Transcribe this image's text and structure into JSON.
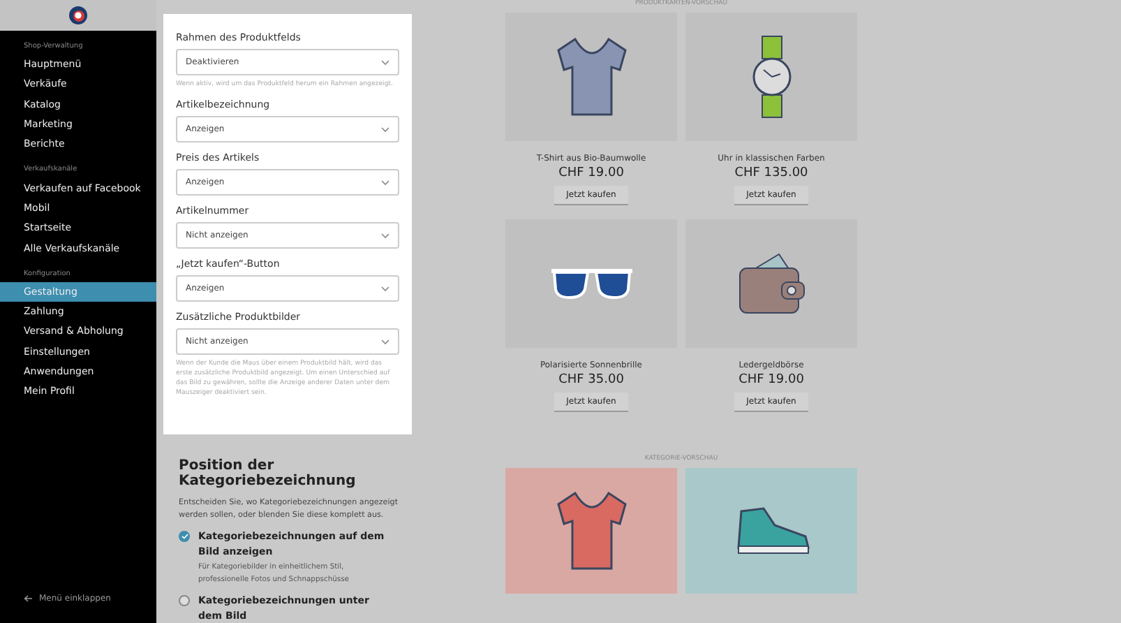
{
  "sidebar": {
    "sections": [
      {
        "title": "Shop-Verwaltung",
        "items": [
          {
            "label": "Hauptmenü",
            "selected": false
          },
          {
            "label": "Verkäufe",
            "selected": false
          },
          {
            "label": "Katalog",
            "selected": false
          },
          {
            "label": "Marketing",
            "selected": false
          },
          {
            "label": "Berichte",
            "selected": false
          }
        ]
      },
      {
        "title": "Verkaufskanäle",
        "items": [
          {
            "label": "Verkaufen auf Facebook",
            "selected": false
          },
          {
            "label": "Mobil",
            "selected": false
          },
          {
            "label": "Startseite",
            "selected": false
          },
          {
            "label": "Alle Verkaufskanäle",
            "selected": false
          }
        ]
      },
      {
        "title": "Konfiguration",
        "items": [
          {
            "label": "Gestaltung",
            "selected": true
          },
          {
            "label": "Zahlung",
            "selected": false
          },
          {
            "label": "Versand & Abholung",
            "selected": false
          },
          {
            "label": "Einstellungen",
            "selected": false
          },
          {
            "label": "Anwendungen",
            "selected": false
          },
          {
            "label": "Mein Profil",
            "selected": false
          }
        ]
      }
    ],
    "collapse": {
      "label": "Menü einklappen"
    }
  },
  "settings_panel": {
    "fields": [
      {
        "label": "Rahmen des Produktfelds",
        "value": "Deaktivieren",
        "hint": "Wenn aktiv, wird um das Produktfeld herum ein Rahmen angezeigt."
      },
      {
        "label": "Artikelbezeichnung",
        "value": "Anzeigen"
      },
      {
        "label": "Preis des Artikels",
        "value": "Anzeigen"
      },
      {
        "label": "Artikelnummer",
        "value": "Nicht anzeigen"
      },
      {
        "label": "„Jetzt kaufen“-Button",
        "value": "Anzeigen"
      },
      {
        "label": "Zusätzliche Produktbilder",
        "value": "Nicht anzeigen",
        "hint": "Wenn der Kunde die Maus über einem Produktbild hält, wird das erste zusätzliche Produktbild angezeigt. Um einen Unterschied auf das Bild zu gewähren, sollte die Anzeige anderer Daten unter dem Mauszeiger deaktiviert sein."
      }
    ]
  },
  "category_section": {
    "title": "Position der Kategoriebezeichnung",
    "description": "Entscheiden Sie, wo Kategoriebezeichnungen angezeigt werden sollen, oder blenden Sie diese komplett aus.",
    "options": [
      {
        "label": "Kategoriebezeichnungen auf dem Bild anzeigen",
        "description": "Für Kategoriebilder in einheitlichem Stil, professionelle Fotos und Schnappschüsse",
        "selected": true
      },
      {
        "label": "Kategoriebezeichnungen unter dem Bild",
        "selected": false
      }
    ]
  },
  "product_preview": {
    "heading": "PRODUKTKARTEN-VORSCHAU",
    "products": [
      {
        "kind": "tshirt",
        "name": "T-Shirt aus Bio-Baumwolle",
        "price": "CHF 19.00",
        "button": "Jetzt kaufen"
      },
      {
        "kind": "watch",
        "name": "Uhr in klassischen Farben",
        "price": "CHF 135.00",
        "button": "Jetzt kaufen"
      },
      {
        "kind": "sunglasses",
        "name": "Polarisierte Sonnenbrille",
        "price": "CHF 35.00",
        "button": "Jetzt kaufen"
      },
      {
        "kind": "wallet",
        "name": "Ledergeldbörse",
        "price": "CHF 19.00",
        "button": "Jetzt kaufen"
      }
    ]
  },
  "category_preview": {
    "heading": "KATEGORIE-VORSCHAU",
    "categories": [
      {
        "kind": "tshirt",
        "color": "#d9a8a2"
      },
      {
        "kind": "sneaker",
        "color": "#a9c8c9"
      }
    ]
  }
}
